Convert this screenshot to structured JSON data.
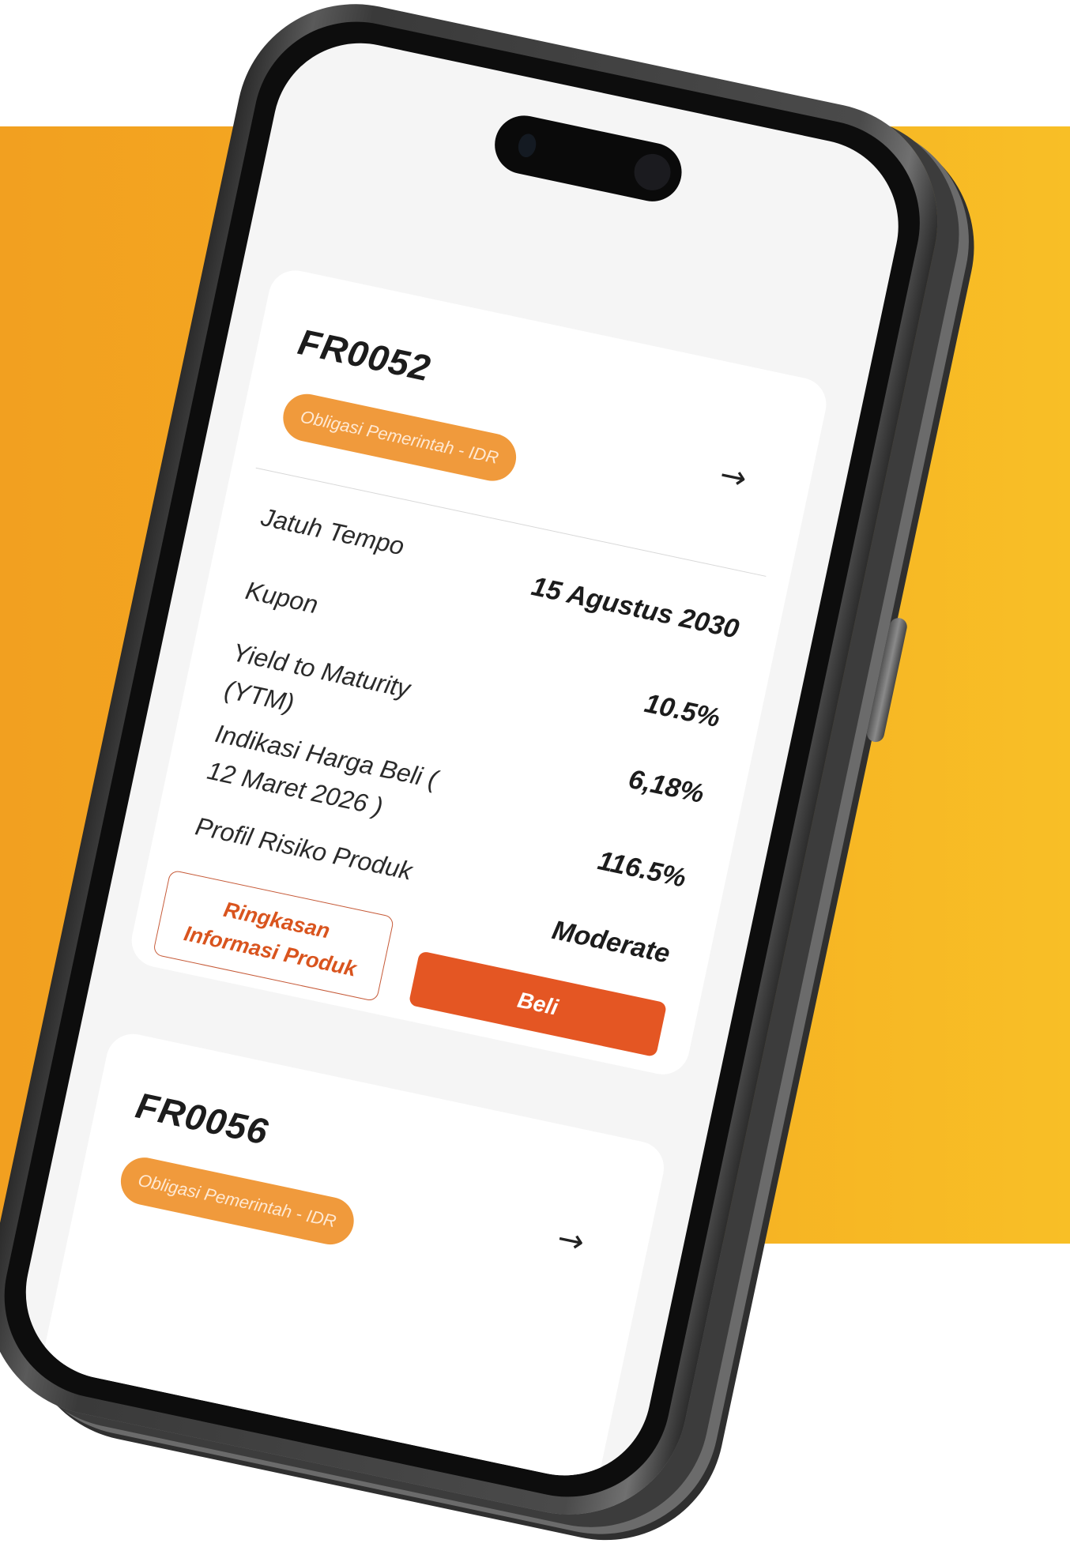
{
  "colors": {
    "background_band": "#f5ac22",
    "badge": "#f09a3c",
    "buy_button": "#e45623",
    "outline_button_text": "#d9541e"
  },
  "cards": [
    {
      "code": "FR0052",
      "badge": "Obligasi Pemerintah - IDR",
      "arrow_icon": "arrow-right-icon",
      "rows": [
        {
          "label": "Jatuh Tempo",
          "value": "15 Agustus 2030"
        },
        {
          "label": "Kupon",
          "value": "10.5%"
        },
        {
          "label": "Yield to Maturity (YTM)",
          "value": "6,18%"
        },
        {
          "label": "Indikasi Harga Beli ( 12 Maret 2026 )",
          "value": "116.5%"
        },
        {
          "label": "Profil Risiko Produk",
          "value": "Moderate"
        }
      ],
      "summary_button": "Ringkasan Informasi Produk",
      "buy_button": "Beli"
    },
    {
      "code": "FR0056",
      "badge": "Obligasi Pemerintah - IDR",
      "arrow_icon": "arrow-right-icon"
    }
  ]
}
